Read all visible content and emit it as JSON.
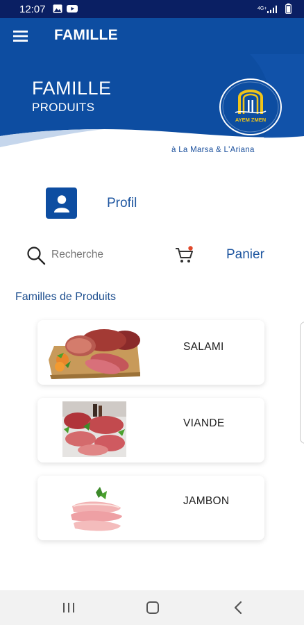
{
  "status_bar": {
    "time": "12:07",
    "network": "4G+"
  },
  "app_bar": {
    "title": "FAMILLE"
  },
  "banner": {
    "title": "FAMILLE",
    "subtitle": "PRODUITS",
    "logo_text": "AYEM ZMEN",
    "location": "à La Marsa & L'Ariana"
  },
  "profile": {
    "label": "Profil"
  },
  "search": {
    "placeholder": "Recherche"
  },
  "cart": {
    "label": "Panier"
  },
  "section": {
    "title": "Familles de Produits"
  },
  "families": [
    {
      "label": "SALAMI"
    },
    {
      "label": "VIANDE"
    },
    {
      "label": "JAMBON"
    }
  ],
  "colors": {
    "status_bar": "#0a1f63",
    "primary": "#0d4da1",
    "text_blue": "#1e56a0",
    "cart_dot": "#e0482b"
  }
}
